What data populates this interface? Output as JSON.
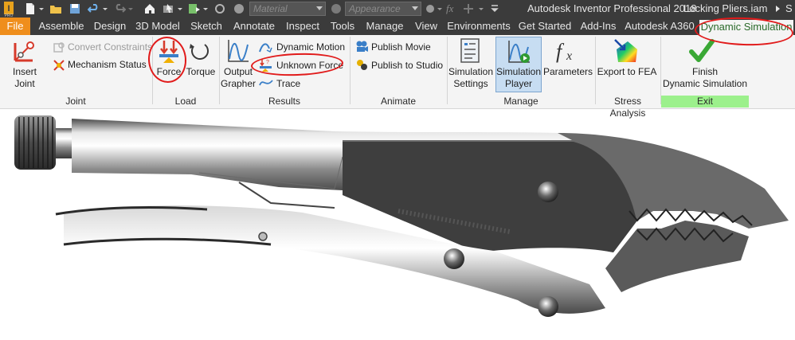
{
  "window": {
    "app_title": "Autodesk Inventor Professional 2018",
    "document_title": "Locking Pliers.iam",
    "overflow_label": "S"
  },
  "quick_access": {
    "material_placeholder": "Material",
    "appearance_placeholder": "Appearance",
    "fx_label": "fx"
  },
  "tabs": [
    "File",
    "Assemble",
    "Design",
    "3D Model",
    "Sketch",
    "Annotate",
    "Inspect",
    "Tools",
    "Manage",
    "View",
    "Environments",
    "Get Started",
    "Add-Ins",
    "Autodesk A360",
    "Dynamic Simulation"
  ],
  "ribbon": {
    "joint": {
      "insert_joint": "Insert Joint",
      "convert_constraints": "Convert Constraints",
      "mechanism_status": "Mechanism Status",
      "label": "Joint"
    },
    "load": {
      "force": "Force",
      "torque": "Torque",
      "label": "Load"
    },
    "results": {
      "output_grapher": [
        "Output",
        "Grapher"
      ],
      "dynamic_motion": "Dynamic Motion",
      "unknown_force": "Unknown Force",
      "trace": "Trace",
      "label": "Results"
    },
    "animate": {
      "publish_movie": "Publish Movie",
      "publish_to_studio": "Publish to Studio",
      "label": "Animate"
    },
    "manage": {
      "simulation_settings": [
        "Simulation",
        "Settings"
      ],
      "simulation_player": [
        "Simulation",
        "Player"
      ],
      "parameters": "Parameters",
      "label": "Manage"
    },
    "stress": {
      "export_to_fea": "Export to FEA",
      "label": "Stress Analysis"
    },
    "exit": {
      "finish": [
        "Finish",
        "Dynamic Simulation"
      ],
      "label": "Exit"
    }
  },
  "colors": {
    "file_tab": "#ef8e1c",
    "exit_panel": "#9cf08c",
    "annotation_red": "#e11b1b",
    "selected_button": "#c7ddf2"
  }
}
